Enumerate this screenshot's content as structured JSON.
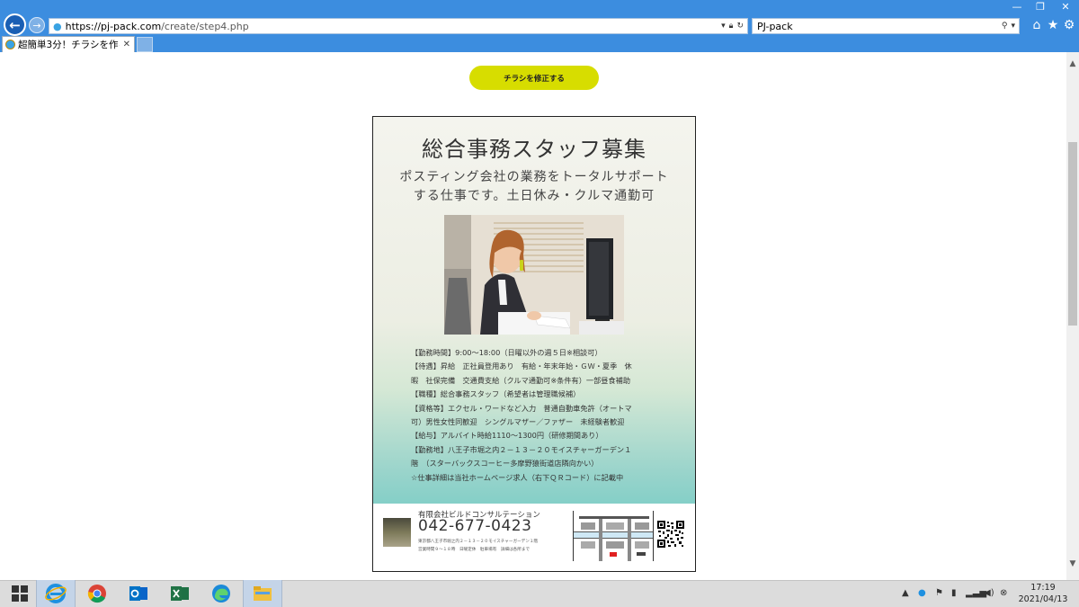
{
  "browser": {
    "url_host": "https://pj-pack.com",
    "url_path": "/create/step4.php",
    "search_text": "PJ-pack",
    "tab_title": "超簡単3分！チラシを作る | ..."
  },
  "page": {
    "fix_button_label": "チラシを修正する"
  },
  "flyer": {
    "title": "総合事務スタッフ募集",
    "subtitle_line1": "ポスティング会社の業務をトータルサポート",
    "subtitle_line2": "する仕事です。土日休み・クルマ通勤可",
    "details": [
      "【勤務時間】9:00～18:00（日曜以外の週５日※相談可）",
      "【待遇】昇給　正社員登用あり　有給・年末年始・ＧＷ・夏季　休",
      "暇　社保完備　交通費支給（クルマ通勤可※条件有）一部昼食補助",
      "【職種】総合事務スタッフ（希望者は管理職候補）",
      "【資格等】エクセル・ワードなど入力　普通自動車免許（オートマ",
      "可）男性女性同歓迎　シングルマザー／ファザー　未経験者歓迎",
      "【給与】アルバイト時給1110～1300円（研修期間あり）",
      "【勤務地】八王子市堀之内２－１３－２０モイスチャーガーデン１",
      "階　（スターバックスコーヒー多摩野猿街道店隣向かい）",
      "☆仕事詳細は当社ホームページ求人（右下ＱＲコード）に記載中"
    ],
    "company_name": "有限会社ビルドコンサルテーション",
    "phone": "042-677-0423",
    "address_small": "東京都八王子市堀之内２－１３－２０モイスチャーガーデン１階",
    "hours_small": "営業時間９～１８時　日曜定休　駐車場有　詳細は各所まで"
  },
  "taskbar": {
    "time": "17:19",
    "date": "2021/04/13"
  },
  "colors": {
    "chrome_blue": "#3c8ddf",
    "button_yellow": "#d7dd00",
    "flyer_teal": "#7ccdc6"
  }
}
